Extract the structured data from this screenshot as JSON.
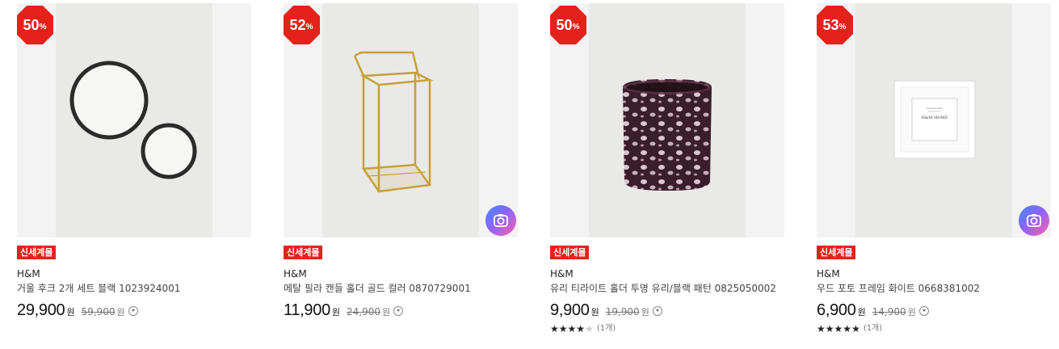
{
  "products": [
    {
      "discount_num": "50",
      "discount_pct": "%",
      "tag": "신세계몰",
      "brand": "H&M",
      "name": "거울 후크 2개 세트 블랙 1023924001",
      "price": "29,900",
      "price_unit": "원",
      "original_price": "59,900",
      "original_unit": "원",
      "image_icon": "round-mirrors-photo",
      "has_camera": false,
      "rating": null,
      "review_count": ""
    },
    {
      "discount_num": "52",
      "discount_pct": "%",
      "tag": "신세계몰",
      "brand": "H&M",
      "name": "메탈 필라 캔들 홀더 골드 컬러 0870729001",
      "price": "11,900",
      "price_unit": "원",
      "original_price": "24,900",
      "original_unit": "원",
      "image_icon": "gold-lantern-photo",
      "has_camera": true,
      "rating": null,
      "review_count": ""
    },
    {
      "discount_num": "50",
      "discount_pct": "%",
      "tag": "신세계몰",
      "brand": "H&M",
      "name": "유리 티라이트 홀더 투명 유리/블랙 패턴 0825050002",
      "price": "9,900",
      "price_unit": "원",
      "original_price": "19,900",
      "original_unit": "원",
      "image_icon": "glass-tealight-photo",
      "has_camera": false,
      "rating": 4,
      "review_count": "(1개)"
    },
    {
      "discount_num": "53",
      "discount_pct": "%",
      "tag": "신세계몰",
      "brand": "H&M",
      "name": "우드 포토 프레임 화이트 0668381002",
      "price": "6,900",
      "price_unit": "원",
      "original_price": "14,900",
      "original_unit": "원",
      "image_icon": "white-photo-frame-photo",
      "frame_text": "H&M HOME",
      "has_camera": true,
      "rating": 5,
      "review_count": "(1개)"
    }
  ],
  "colors": {
    "badge_red": "#e3231b",
    "tag_red": "#e3231b",
    "camera_gradient": [
      "#3f8cff",
      "#8a63ff",
      "#ff5fa8"
    ]
  },
  "rating_max": 5
}
